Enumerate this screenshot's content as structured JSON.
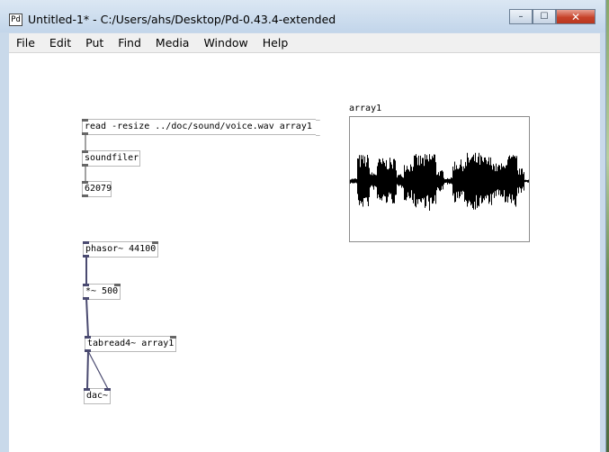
{
  "window": {
    "title": "Untitled-1* - C:/Users/ahs/Desktop/Pd-0.43.4-extended",
    "app_icon_glyph": "Pd",
    "minimize": "–",
    "maximize": "☐",
    "close": "✕"
  },
  "menu": [
    "File",
    "Edit",
    "Put",
    "Find",
    "Media",
    "Window",
    "Help"
  ],
  "patch": {
    "msg_read": "read -resize ../doc/sound/voice.wav array1",
    "obj_soundfiler": "soundfiler",
    "atom_count": "62079",
    "obj_phasor": "phasor~ 44100",
    "obj_mult": "*~ 500",
    "obj_tabread": "tabread4~ array1",
    "obj_dac": "dac~"
  },
  "array": {
    "name": "array1"
  },
  "colors": {
    "titlebar": "#c9d9ea",
    "close_button": "#c7432b",
    "control_cord": "#444444",
    "signal_cord": "#4a4a70"
  }
}
